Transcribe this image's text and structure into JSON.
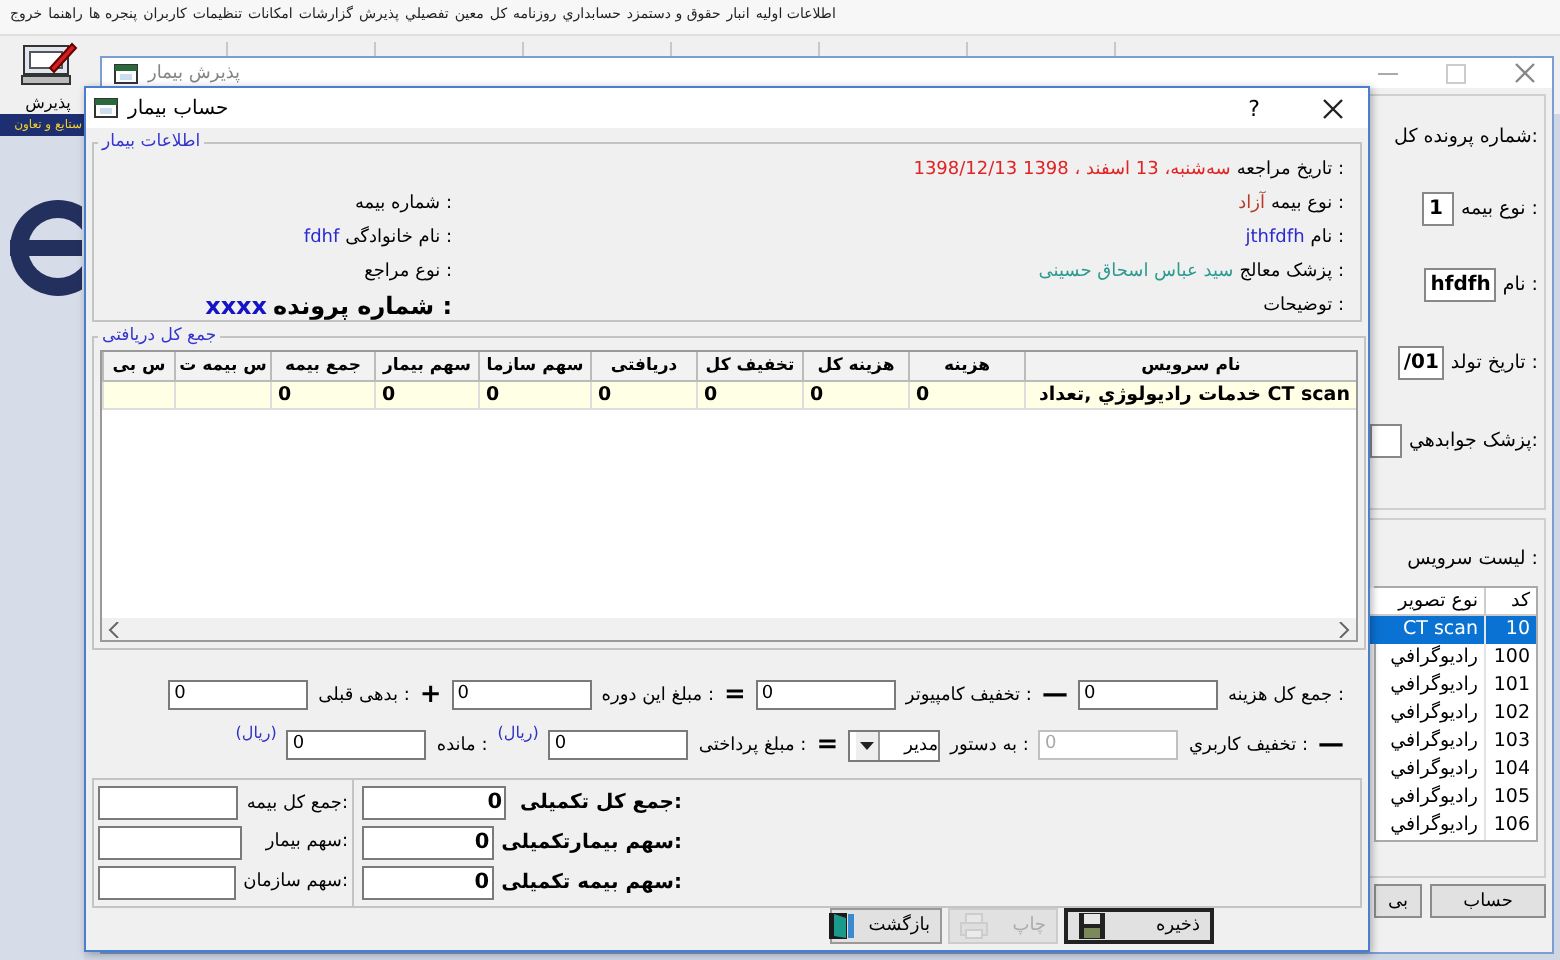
{
  "menu_bar": {
    "items": [
      "اطلاعات اولیه",
      "انبار",
      "حقوق و دستمزد",
      "حسابداري",
      "روزنامه",
      "کل",
      "معین",
      "تفصيلي",
      "پذیرش",
      "گزارشات",
      "امکانات",
      "تنظیمات",
      "کاربران",
      "پنجره ها",
      "راهنما",
      "خروج"
    ]
  },
  "toolbar": {
    "buttons": [
      {
        "label": "پذیرش"
      }
    ]
  },
  "side_banner": {
    "text": "ستایع و تعاون"
  },
  "background_window": {
    "title": "پذیرش بیمار",
    "fields": [
      {
        "label": ":شماره پرونده کل"
      },
      {
        "label": ": نوع بیمه",
        "value": "1"
      },
      {
        "label": ": نام",
        "value": "hfdfh"
      },
      {
        "label": ": تاریخ تولد",
        "value": "/01"
      },
      {
        "label": ":پزشک جوابدهي",
        "value_box": true
      }
    ],
    "service_list": {
      "label": ": لیست سرویس",
      "columns": [
        "کد",
        "نوع تصویر"
      ],
      "rows": [
        {
          "cells": [
            "10",
            "CT scan"
          ],
          "selected": true
        },
        {
          "cells": [
            "100",
            "رادیوگرافي"
          ],
          "selected": false
        },
        {
          "cells": [
            "101",
            "رادیوگرافي"
          ],
          "selected": false
        },
        {
          "cells": [
            "102",
            "رادیوگرافي"
          ],
          "selected": false
        },
        {
          "cells": [
            "103",
            "رادیوگرافي"
          ],
          "selected": false
        },
        {
          "cells": [
            "104",
            "رادیوگرافي"
          ],
          "selected": false
        },
        {
          "cells": [
            "105",
            "رادیوگرافي"
          ],
          "selected": false
        },
        {
          "cells": [
            "106",
            "رادیوگرافي"
          ],
          "selected": false
        }
      ]
    },
    "buttons": [
      "حساب",
      "بی"
    ]
  },
  "dialog": {
    "title": "حساب بیمار",
    "help": "?",
    "patient_info": {
      "legend": "اطلاعات بیمار",
      "rows": [
        [
          {
            "label": ": تاریخ مراجعه",
            "value": "سه‌شنبه، 13 اسفند ، 1398  1398/12/13",
            "color": "#e02424",
            "kind": "plain"
          }
        ],
        [
          {
            "label": ": نوع بیمه",
            "value": "آزاد",
            "color": "#b83a28",
            "kind": "plain"
          },
          {
            "label": ": شماره بیمه",
            "kind": "plain"
          }
        ],
        [
          {
            "label": ": نام",
            "value": "jthfdfh",
            "color": "#2a2ad0",
            "kind": "plain"
          },
          {
            "label": ": نام خانوادگی",
            "value": "fdhf",
            "color": "#2a2ad0",
            "kind": "plain"
          }
        ],
        [
          {
            "label": ": پزشک معالج",
            "value": "سید عباس اسحاق حسینی",
            "color": "#2a9a90",
            "kind": "plain"
          },
          {
            "label": ": نوع مراجع",
            "kind": "plain"
          }
        ],
        [
          {
            "label": ": توضیحات",
            "kind": "plain"
          },
          {
            "label": ": شماره پرونده",
            "value": "xxxx",
            "color": "#1414c8",
            "kind": "emphasis"
          }
        ]
      ]
    },
    "charges": {
      "legend": "جمع کل دریافتی",
      "columns": [
        "نام سرویس",
        "هزینه",
        "هزینه کل",
        "تخفیف کل",
        "دریافتی",
        "سهم سازما",
        "سهم بیمار",
        "جمع بیمه",
        "س بیمه ت",
        "س بی"
      ],
      "rows": [
        {
          "cells": [
            "CT scan خدمات رادیولوژي ,تعداد",
            "0",
            "0",
            "0",
            "0",
            "0",
            "0",
            "0"
          ]
        }
      ]
    },
    "totals": {
      "row_1": [
        {
          "kind": "label",
          "text": ": جمع کل هزینه"
        },
        {
          "kind": "field",
          "value": "0",
          "disabled": false
        },
        {
          "kind": "operator",
          "text": "—"
        },
        {
          "kind": "label",
          "text": ": تخفیف کامپیوتر"
        },
        {
          "kind": "field",
          "value": "0",
          "disabled": false
        },
        {
          "kind": "operator",
          "text": "="
        },
        {
          "kind": "label",
          "text": ": مبلغ این دوره"
        },
        {
          "kind": "field",
          "value": "0",
          "disabled": false
        },
        {
          "kind": "operator",
          "text": "+"
        },
        {
          "kind": "label",
          "text": ": بدهی قبلی"
        },
        {
          "kind": "field",
          "value": "0",
          "disabled": false
        }
      ],
      "row_2": [
        {
          "kind": "operator",
          "text": "—"
        },
        {
          "kind": "label",
          "text": ": تخفیف کاربري"
        },
        {
          "kind": "field",
          "value": "0",
          "disabled": true
        },
        {
          "kind": "label",
          "text": ": به دستور"
        },
        {
          "kind": "select",
          "value": "مدیر"
        },
        {
          "kind": "operator",
          "text": "="
        },
        {
          "kind": "label",
          "text": ": مبلغ پرداختی"
        },
        {
          "kind": "field",
          "value": "0",
          "disabled": false
        },
        {
          "kind": "unit",
          "text": "(ریال)"
        },
        {
          "kind": "label",
          "text": ": مانده"
        },
        {
          "kind": "field",
          "value": "0",
          "disabled": false
        },
        {
          "kind": "unit",
          "text": "(ریال)"
        }
      ]
    },
    "insurance_totals": [
      {
        "label": ":جمع کل بیمه"
      },
      {
        "label": ":سهم بیمار"
      },
      {
        "label": ":سهم سازمان"
      }
    ],
    "supplementary_totals": [
      {
        "label": ":جمع کل تکمیلی",
        "value": "0"
      },
      {
        "label": ":سهم بیمارتکمیلی",
        "value": "0"
      },
      {
        "label": ":سهم بیمه تکمیلی",
        "value": "0"
      }
    ],
    "buttons": [
      {
        "label": "ذخیره",
        "kind": "save",
        "disabled": false,
        "focused": true
      },
      {
        "label": "چاپ",
        "kind": "print",
        "disabled": true,
        "focused": false
      },
      {
        "label": "بازگشت",
        "kind": "exit",
        "disabled": false,
        "focused": false
      }
    ]
  }
}
